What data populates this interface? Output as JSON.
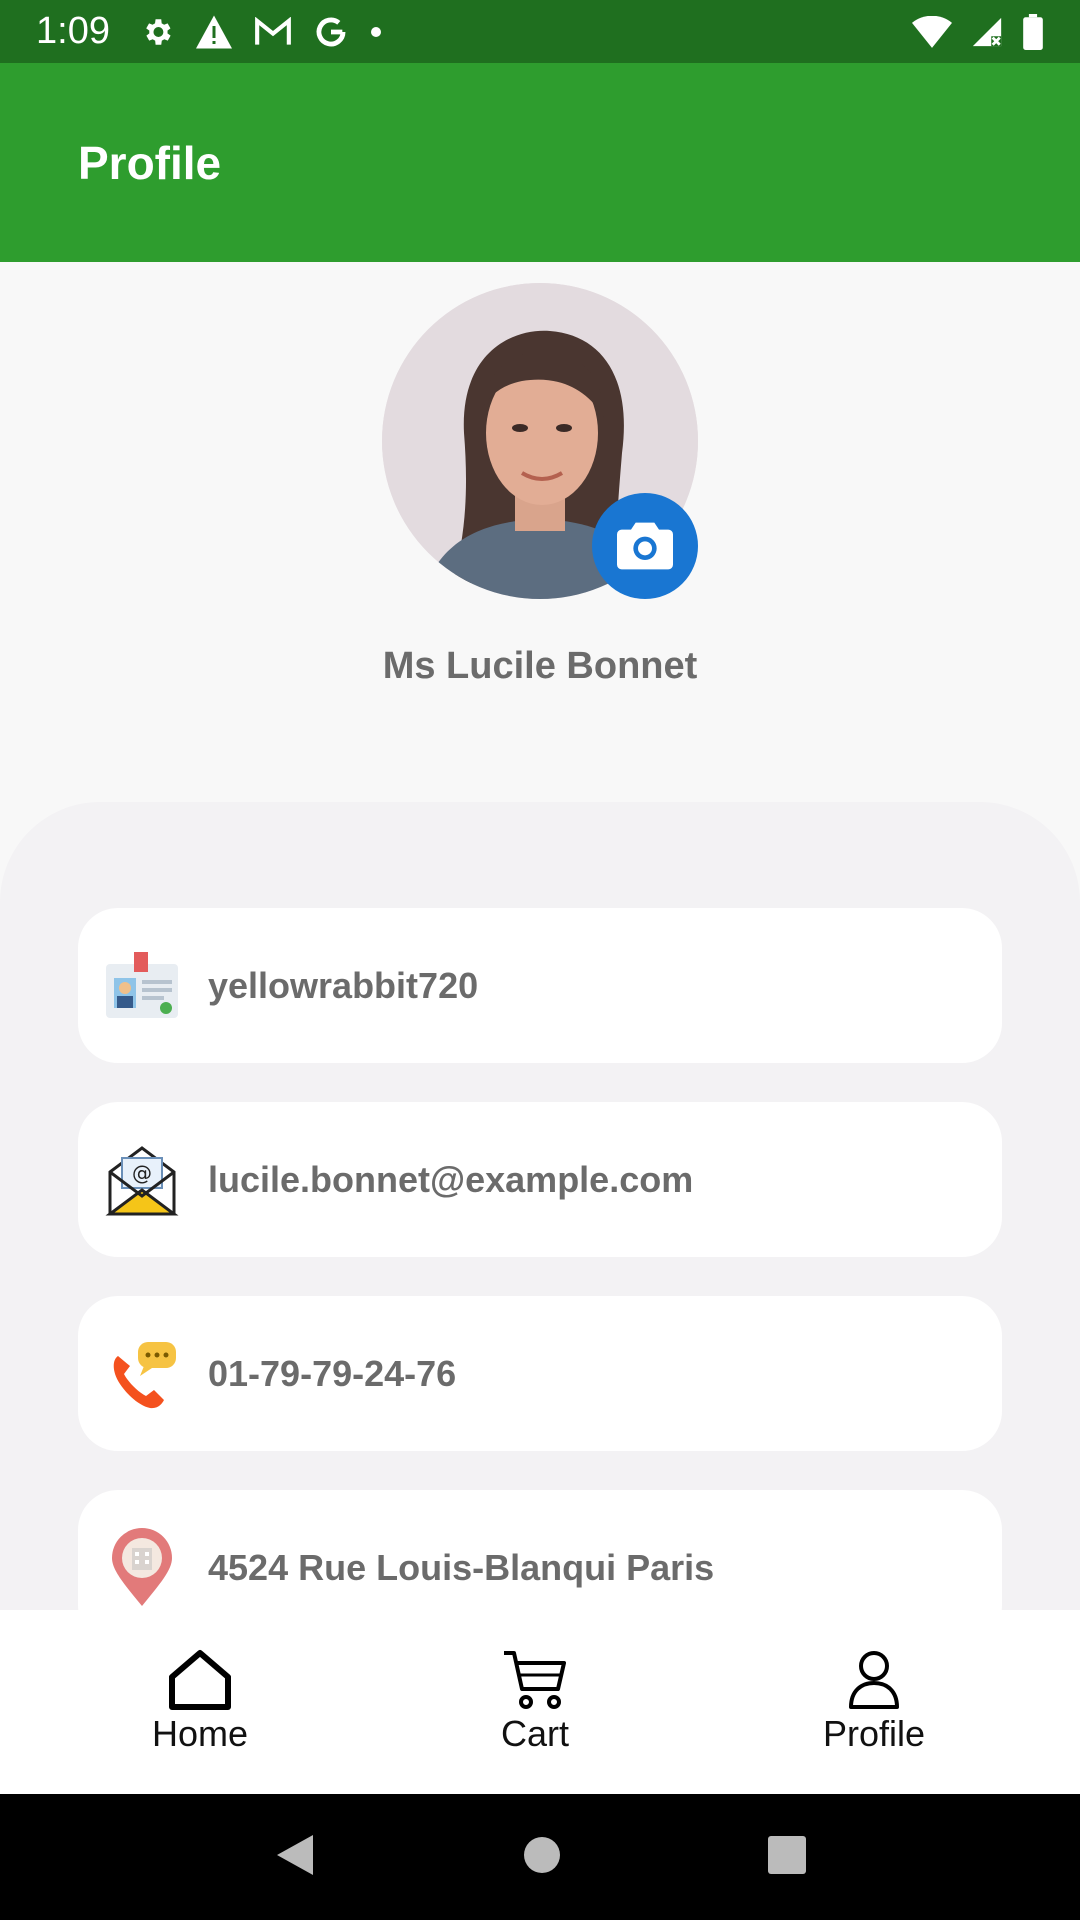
{
  "status_bar": {
    "time": "1:09"
  },
  "app_bar": {
    "title": "Profile"
  },
  "profile": {
    "name": "Ms Lucile Bonnet"
  },
  "info": {
    "username": "yellowrabbit720",
    "email": "lucile.bonnet@example.com",
    "phone": "01-79-79-24-76",
    "address": "4524 Rue Louis-Blanqui Paris"
  },
  "bottom_nav": {
    "items": [
      {
        "label": "Home",
        "icon": "home-icon"
      },
      {
        "label": "Cart",
        "icon": "cart-icon"
      },
      {
        "label": "Profile",
        "icon": "person-icon"
      }
    ]
  },
  "colors": {
    "status_bar": "#1f6f1f",
    "app_bar": "#2e9d2e",
    "camera_button": "#1976d2"
  }
}
